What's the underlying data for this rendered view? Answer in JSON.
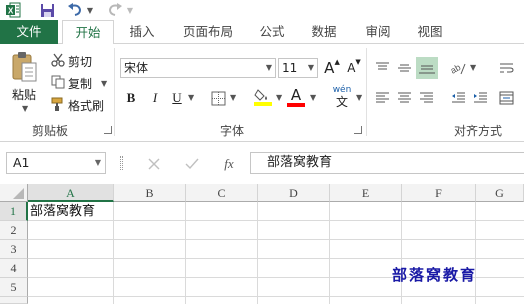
{
  "tabs": [
    "文件",
    "开始",
    "插入",
    "页面布局",
    "公式",
    "数据",
    "审阅",
    "视图"
  ],
  "clipboard": {
    "paste": "粘贴",
    "cut": "剪切",
    "copy": "复制",
    "format_painter": "格式刷",
    "group": "剪贴板"
  },
  "font": {
    "name": "宋体",
    "size": "11",
    "bold": "B",
    "italic": "I",
    "underline": "U",
    "grow": "A",
    "shrink": "A",
    "font_color_letter": "A",
    "phonetic": "wén",
    "phonetic_sub": "文",
    "group": "字体",
    "fill_color": "#ffff00",
    "text_color": "#ff0000"
  },
  "alignment": {
    "group": "对齐方式",
    "highlight_color": "#bcdcc4"
  },
  "formula_bar": {
    "name_box": "A1",
    "fx": "fx",
    "content": "部落窝教育"
  },
  "grid": {
    "columns": [
      "A",
      "B",
      "C",
      "D",
      "E",
      "F",
      "G"
    ],
    "rows": [
      "1",
      "2",
      "3",
      "4",
      "5",
      "6"
    ],
    "a1": "部落窝教育",
    "watermark": "部落窝教育",
    "watermark_color": "#1a1aa6"
  },
  "colors": {
    "brand": "#217346"
  }
}
